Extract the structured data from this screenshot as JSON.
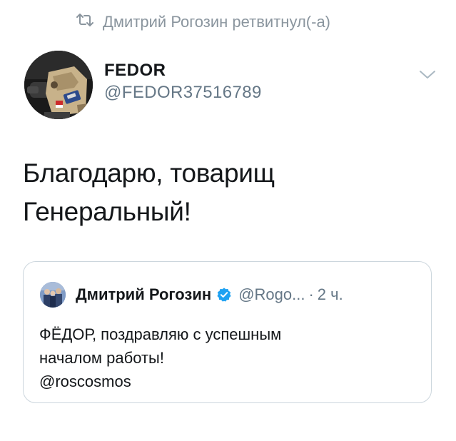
{
  "retweet": {
    "text": "Дмитрий Рогозин ретвитнул(-а)",
    "icon": "retweet-icon"
  },
  "author": {
    "name": "FEDOR",
    "handle": "@FEDOR37516789",
    "avatar_icon": "robot-avatar"
  },
  "tweet": {
    "line1": "Благодарю, товарищ",
    "line2": "Генеральный!"
  },
  "quoted": {
    "name": "Дмитрий Рогозин",
    "verified": true,
    "handle": "@Rogo...",
    "separator": "·",
    "time": "2 ч.",
    "line1": "ФЁДОР, поздравляю с успешным",
    "line2": "началом работы!",
    "line3": "@roscosmos"
  },
  "colors": {
    "muted": "#657786",
    "verified_blue": "#1da1f2",
    "border": "#ccd6dd"
  }
}
